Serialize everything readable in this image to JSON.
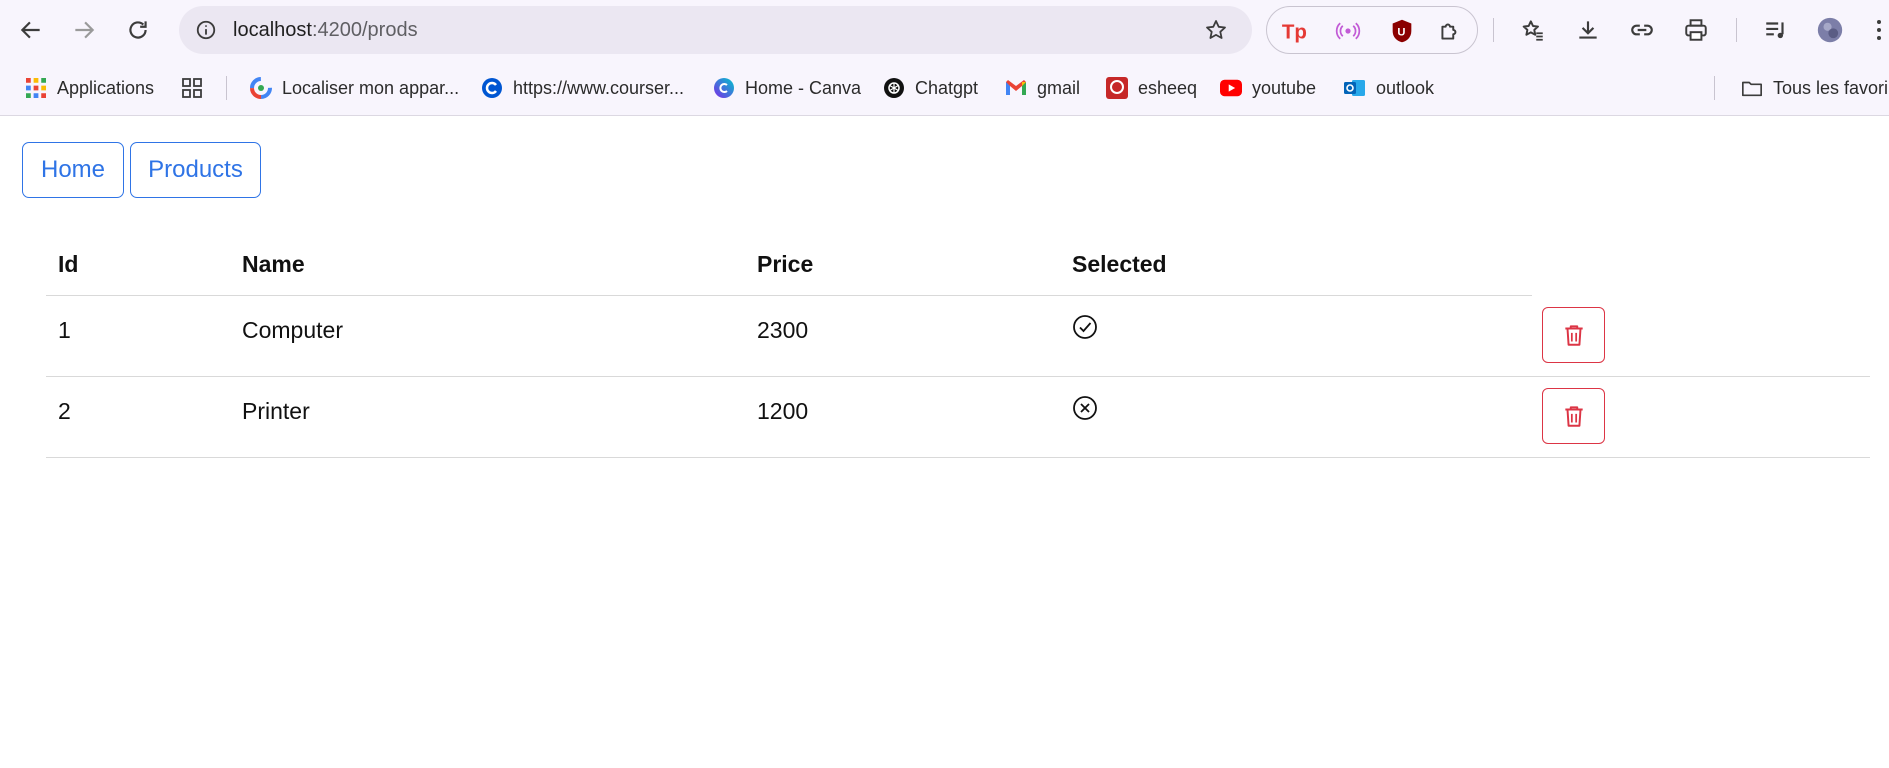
{
  "browser": {
    "url_host": "localhost",
    "url_path": ":4200/prods",
    "bookmarks": [
      {
        "label": "Applications",
        "icon": "apps-grid-icon"
      },
      {
        "label": "",
        "icon": "tab-groups-icon"
      },
      {
        "label": "Localiser mon appar...",
        "icon": "google-find-icon"
      },
      {
        "label": "https://www.courser...",
        "icon": "coursera-icon"
      },
      {
        "label": "Home - Canva",
        "icon": "canva-icon"
      },
      {
        "label": "Chatgpt",
        "icon": "openai-icon"
      },
      {
        "label": "gmail",
        "icon": "gmail-icon"
      },
      {
        "label": "esheeq",
        "icon": "esheeq-icon"
      },
      {
        "label": "youtube",
        "icon": "youtube-icon"
      },
      {
        "label": "outlook",
        "icon": "outlook-icon"
      }
    ],
    "all_bookmarks_label": "Tous les favori"
  },
  "nav": {
    "home_label": "Home",
    "products_label": "Products"
  },
  "table": {
    "headers": {
      "id": "Id",
      "name": "Name",
      "price": "Price",
      "selected": "Selected"
    },
    "rows": [
      {
        "id": "1",
        "name": "Computer",
        "price": "2300",
        "selected": true
      },
      {
        "id": "2",
        "name": "Printer",
        "price": "1200",
        "selected": false
      }
    ]
  },
  "colors": {
    "accent": "#2f74e6",
    "danger": "#dc3545",
    "chrome_bg": "#f8f5fd"
  }
}
